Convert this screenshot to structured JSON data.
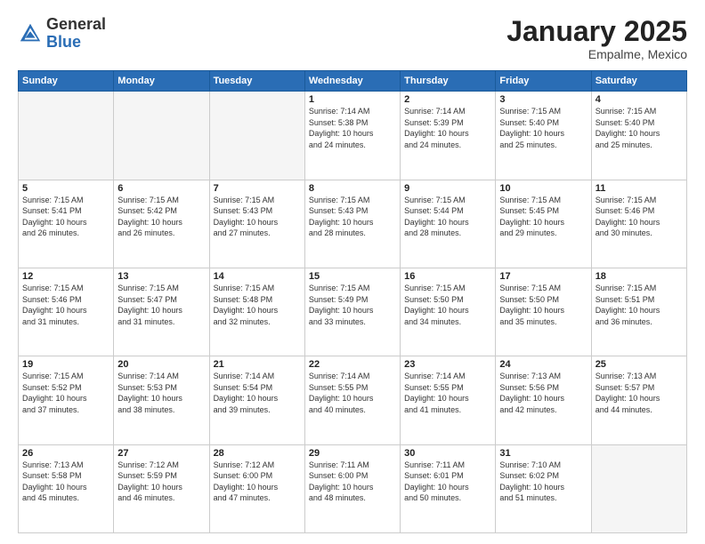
{
  "header": {
    "logo_general": "General",
    "logo_blue": "Blue",
    "month_title": "January 2025",
    "subtitle": "Empalme, Mexico"
  },
  "weekdays": [
    "Sunday",
    "Monday",
    "Tuesday",
    "Wednesday",
    "Thursday",
    "Friday",
    "Saturday"
  ],
  "weeks": [
    [
      {
        "day": "",
        "info": ""
      },
      {
        "day": "",
        "info": ""
      },
      {
        "day": "",
        "info": ""
      },
      {
        "day": "1",
        "info": "Sunrise: 7:14 AM\nSunset: 5:38 PM\nDaylight: 10 hours\nand 24 minutes."
      },
      {
        "day": "2",
        "info": "Sunrise: 7:14 AM\nSunset: 5:39 PM\nDaylight: 10 hours\nand 24 minutes."
      },
      {
        "day": "3",
        "info": "Sunrise: 7:15 AM\nSunset: 5:40 PM\nDaylight: 10 hours\nand 25 minutes."
      },
      {
        "day": "4",
        "info": "Sunrise: 7:15 AM\nSunset: 5:40 PM\nDaylight: 10 hours\nand 25 minutes."
      }
    ],
    [
      {
        "day": "5",
        "info": "Sunrise: 7:15 AM\nSunset: 5:41 PM\nDaylight: 10 hours\nand 26 minutes."
      },
      {
        "day": "6",
        "info": "Sunrise: 7:15 AM\nSunset: 5:42 PM\nDaylight: 10 hours\nand 26 minutes."
      },
      {
        "day": "7",
        "info": "Sunrise: 7:15 AM\nSunset: 5:43 PM\nDaylight: 10 hours\nand 27 minutes."
      },
      {
        "day": "8",
        "info": "Sunrise: 7:15 AM\nSunset: 5:43 PM\nDaylight: 10 hours\nand 28 minutes."
      },
      {
        "day": "9",
        "info": "Sunrise: 7:15 AM\nSunset: 5:44 PM\nDaylight: 10 hours\nand 28 minutes."
      },
      {
        "day": "10",
        "info": "Sunrise: 7:15 AM\nSunset: 5:45 PM\nDaylight: 10 hours\nand 29 minutes."
      },
      {
        "day": "11",
        "info": "Sunrise: 7:15 AM\nSunset: 5:46 PM\nDaylight: 10 hours\nand 30 minutes."
      }
    ],
    [
      {
        "day": "12",
        "info": "Sunrise: 7:15 AM\nSunset: 5:46 PM\nDaylight: 10 hours\nand 31 minutes."
      },
      {
        "day": "13",
        "info": "Sunrise: 7:15 AM\nSunset: 5:47 PM\nDaylight: 10 hours\nand 31 minutes."
      },
      {
        "day": "14",
        "info": "Sunrise: 7:15 AM\nSunset: 5:48 PM\nDaylight: 10 hours\nand 32 minutes."
      },
      {
        "day": "15",
        "info": "Sunrise: 7:15 AM\nSunset: 5:49 PM\nDaylight: 10 hours\nand 33 minutes."
      },
      {
        "day": "16",
        "info": "Sunrise: 7:15 AM\nSunset: 5:50 PM\nDaylight: 10 hours\nand 34 minutes."
      },
      {
        "day": "17",
        "info": "Sunrise: 7:15 AM\nSunset: 5:50 PM\nDaylight: 10 hours\nand 35 minutes."
      },
      {
        "day": "18",
        "info": "Sunrise: 7:15 AM\nSunset: 5:51 PM\nDaylight: 10 hours\nand 36 minutes."
      }
    ],
    [
      {
        "day": "19",
        "info": "Sunrise: 7:15 AM\nSunset: 5:52 PM\nDaylight: 10 hours\nand 37 minutes."
      },
      {
        "day": "20",
        "info": "Sunrise: 7:14 AM\nSunset: 5:53 PM\nDaylight: 10 hours\nand 38 minutes."
      },
      {
        "day": "21",
        "info": "Sunrise: 7:14 AM\nSunset: 5:54 PM\nDaylight: 10 hours\nand 39 minutes."
      },
      {
        "day": "22",
        "info": "Sunrise: 7:14 AM\nSunset: 5:55 PM\nDaylight: 10 hours\nand 40 minutes."
      },
      {
        "day": "23",
        "info": "Sunrise: 7:14 AM\nSunset: 5:55 PM\nDaylight: 10 hours\nand 41 minutes."
      },
      {
        "day": "24",
        "info": "Sunrise: 7:13 AM\nSunset: 5:56 PM\nDaylight: 10 hours\nand 42 minutes."
      },
      {
        "day": "25",
        "info": "Sunrise: 7:13 AM\nSunset: 5:57 PM\nDaylight: 10 hours\nand 44 minutes."
      }
    ],
    [
      {
        "day": "26",
        "info": "Sunrise: 7:13 AM\nSunset: 5:58 PM\nDaylight: 10 hours\nand 45 minutes."
      },
      {
        "day": "27",
        "info": "Sunrise: 7:12 AM\nSunset: 5:59 PM\nDaylight: 10 hours\nand 46 minutes."
      },
      {
        "day": "28",
        "info": "Sunrise: 7:12 AM\nSunset: 6:00 PM\nDaylight: 10 hours\nand 47 minutes."
      },
      {
        "day": "29",
        "info": "Sunrise: 7:11 AM\nSunset: 6:00 PM\nDaylight: 10 hours\nand 48 minutes."
      },
      {
        "day": "30",
        "info": "Sunrise: 7:11 AM\nSunset: 6:01 PM\nDaylight: 10 hours\nand 50 minutes."
      },
      {
        "day": "31",
        "info": "Sunrise: 7:10 AM\nSunset: 6:02 PM\nDaylight: 10 hours\nand 51 minutes."
      },
      {
        "day": "",
        "info": ""
      }
    ]
  ]
}
